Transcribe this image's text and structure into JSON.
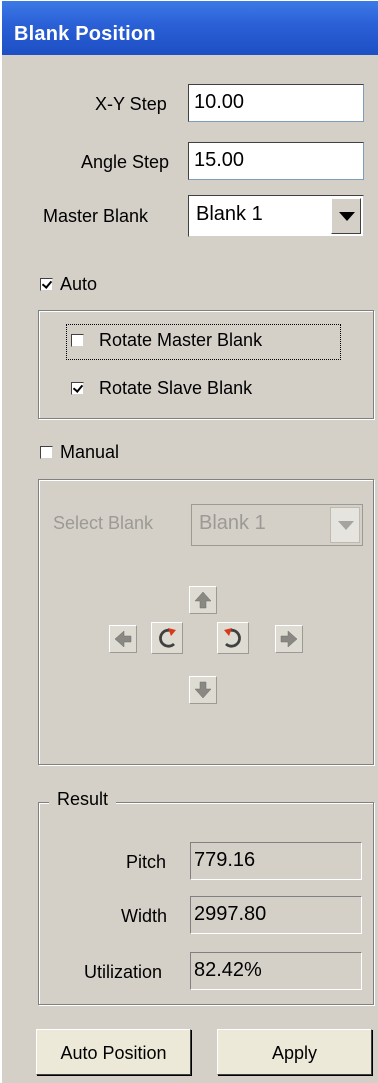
{
  "window": {
    "title": "Blank Position"
  },
  "fields": {
    "xy_step": {
      "label": "X-Y Step",
      "value": "10.00"
    },
    "angle_step": {
      "label": "Angle Step",
      "value": "15.00"
    },
    "master_blank": {
      "label": "Master Blank",
      "value": "Blank 1"
    }
  },
  "auto": {
    "label": "Auto",
    "checked": true,
    "rotate_master": {
      "label": "Rotate Master Blank",
      "checked": false
    },
    "rotate_slave": {
      "label": "Rotate Slave Blank",
      "checked": true
    }
  },
  "manual": {
    "label": "Manual",
    "checked": false,
    "select_blank": {
      "label": "Select Blank",
      "value": "Blank 1"
    },
    "controls": [
      "up-arrow-icon",
      "left-arrow-icon",
      "rotate-clockwise-icon",
      "rotate-counterclockwise-icon",
      "right-arrow-icon",
      "down-arrow-icon"
    ]
  },
  "result": {
    "legend": "Result",
    "pitch": {
      "label": "Pitch",
      "value": "779.16"
    },
    "width": {
      "label": "Width",
      "value": "2997.80"
    },
    "utilization": {
      "label": "Utilization",
      "value": "82.42%"
    }
  },
  "buttons": {
    "auto_position": "Auto Position",
    "apply": "Apply"
  },
  "colors": {
    "titlebar": "#2a5fd6",
    "face": "#d4d0c8",
    "rotate_accent": "#d83a1a"
  }
}
